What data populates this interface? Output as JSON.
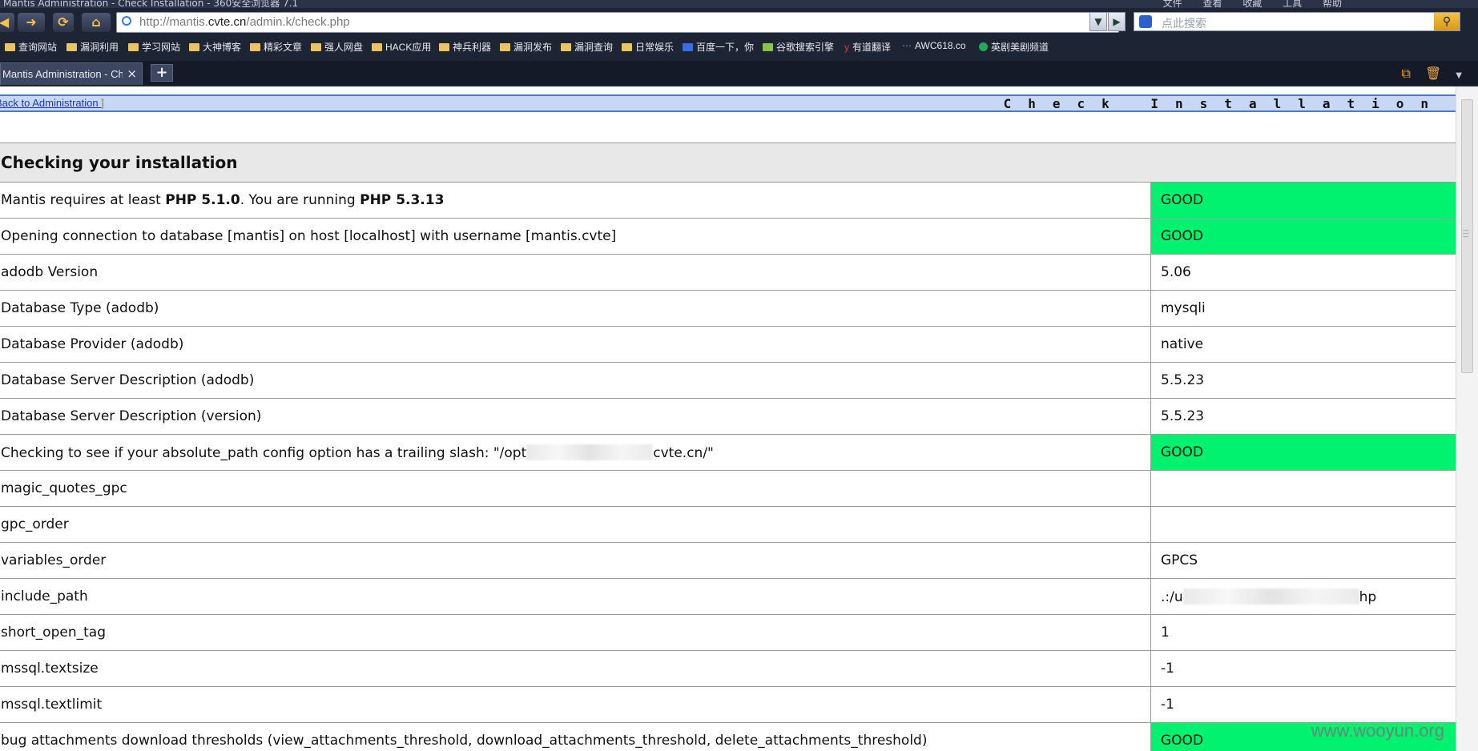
{
  "window": {
    "title": "Mantis Administration - Check Installation - 360安全浏览器 7.1",
    "menu": [
      "文件",
      "查看",
      "收藏",
      "工具",
      "帮助"
    ]
  },
  "toolbar": {
    "back_icon": "arrow-left-icon",
    "forward_icon": "arrow-right-icon",
    "refresh_icon": "refresh-icon",
    "home_icon": "home-icon",
    "url_prefix": "http://mantis.",
    "url_domain": "cvte.cn",
    "url_path": "/admin.k/check.php",
    "search_placeholder": "点此搜索"
  },
  "bookmarks": [
    "查询网站",
    "漏洞利用",
    "学习网站",
    "大神博客",
    "精彩文章",
    "强人网盘",
    "HACK应用",
    "神兵利器",
    "漏洞发布",
    "漏洞查询",
    "日常娱乐",
    "百度一下，你",
    "谷歌搜索引擎",
    "有道翻译",
    "AWC618.co",
    "英剧美剧频道"
  ],
  "tab": {
    "title": "Mantis Administration - Ch",
    "close": "×",
    "new_tab": "+"
  },
  "page": {
    "back_link": "Back to Administration",
    "back_bracket": "]",
    "title": "Check Installation",
    "section_heading": "Checking your installation"
  },
  "rows": [
    {
      "label_pre": "Mantis requires at least ",
      "b1": "PHP 5.1.0",
      "mid": ". You are running ",
      "b2": "PHP 5.3.13",
      "value": "GOOD",
      "good": true
    },
    {
      "label": "Opening connection to database [mantis] on host [localhost] with username [mantis.cvte]",
      "value": "GOOD",
      "good": true
    },
    {
      "label": "adodb Version",
      "value": "5.06",
      "good": false
    },
    {
      "label": "Database Type (adodb)",
      "value": "mysqli",
      "good": false
    },
    {
      "label": "Database Provider (adodb)",
      "value": "native",
      "good": false
    },
    {
      "label": "Database Server Description (adodb)",
      "value": "5.5.23",
      "good": false
    },
    {
      "label": "Database Server Description (version)",
      "value": "5.5.23",
      "good": false
    },
    {
      "label_pre": "Checking to see if your absolute_path config option has a trailing slash: \"/opt",
      "label_post": "cvte.cn/\"",
      "value": "GOOD",
      "good": true
    },
    {
      "label": "magic_quotes_gpc",
      "value": "",
      "good": false
    },
    {
      "label": "gpc_order",
      "value": "",
      "good": false
    },
    {
      "label": "variables_order",
      "value": "GPCS",
      "good": false
    },
    {
      "label": "include_path",
      "value_pre": ".:/u",
      "value_post": "hp",
      "good": false
    },
    {
      "label": "short_open_tag",
      "value": "1",
      "good": false
    },
    {
      "label": "mssql.textsize",
      "value": "-1",
      "good": false
    },
    {
      "label": "mssql.textlimit",
      "value": "-1",
      "good": false
    },
    {
      "label": "bug attachments download thresholds (view_attachments_threshold, download_attachments_threshold, delete_attachments_threshold)",
      "value": "GOOD",
      "good": true
    }
  ],
  "watermark": "www.wooyun.org",
  "colors": {
    "good": "#00f26f",
    "header_band": "#c8d8f4",
    "chrome": "#1d2535"
  }
}
